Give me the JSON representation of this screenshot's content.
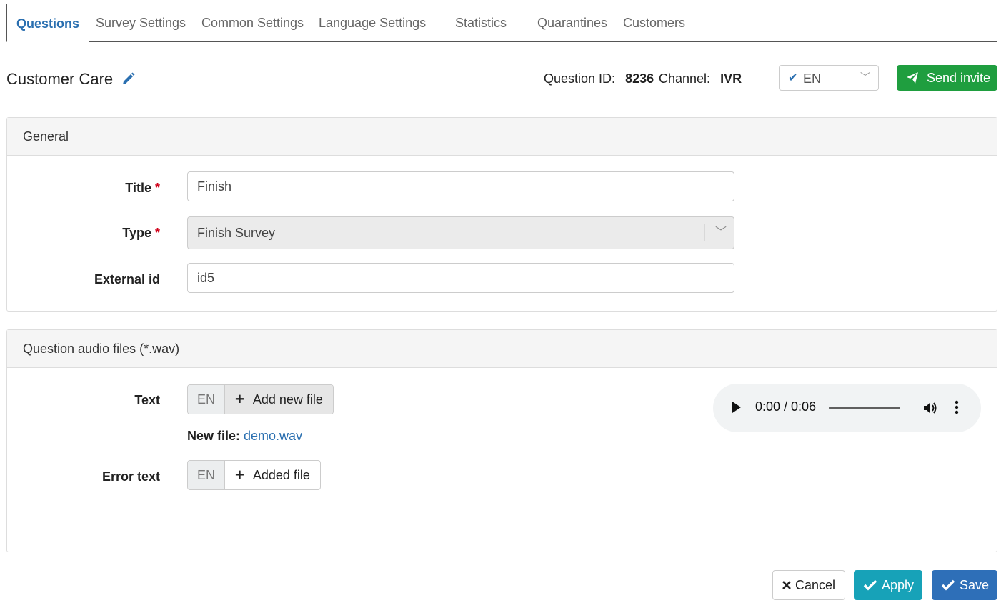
{
  "tabs": [
    {
      "label": "Questions",
      "active": true
    },
    {
      "label": "Survey Settings"
    },
    {
      "label": "Common Settings"
    },
    {
      "label": "Language Settings"
    },
    {
      "label": "Statistics"
    },
    {
      "label": "Quarantines"
    },
    {
      "label": "Customers"
    }
  ],
  "header": {
    "title": "Customer Care",
    "question_id_label": "Question ID:",
    "question_id": "8236",
    "channel_label": "Channel:",
    "channel": "IVR",
    "language": "EN",
    "send_invite": "Send invite"
  },
  "general": {
    "heading": "General",
    "title_label": "Title",
    "title_value": "Finish",
    "type_label": "Type",
    "type_value": "Finish Survey",
    "external_id_label": "External id",
    "external_id_value": "id5",
    "required_mark": "*"
  },
  "audio": {
    "heading": "Question audio files (*.wav)",
    "text_label": "Text",
    "text_lang": "EN",
    "text_button": "Add new file",
    "new_file_label": "New file:",
    "new_file_name": "demo.wav",
    "error_label": "Error text",
    "error_lang": "EN",
    "error_button": "Added file",
    "player_time": "0:00 / 0:06"
  },
  "footer": {
    "cancel": "Cancel",
    "apply": "Apply",
    "save": "Save"
  },
  "colors": {
    "accent": "#2a6fb0",
    "send": "#1f9e3f",
    "apply": "#17a2b8",
    "save": "#2e6fb8",
    "required": "#d0021b"
  }
}
